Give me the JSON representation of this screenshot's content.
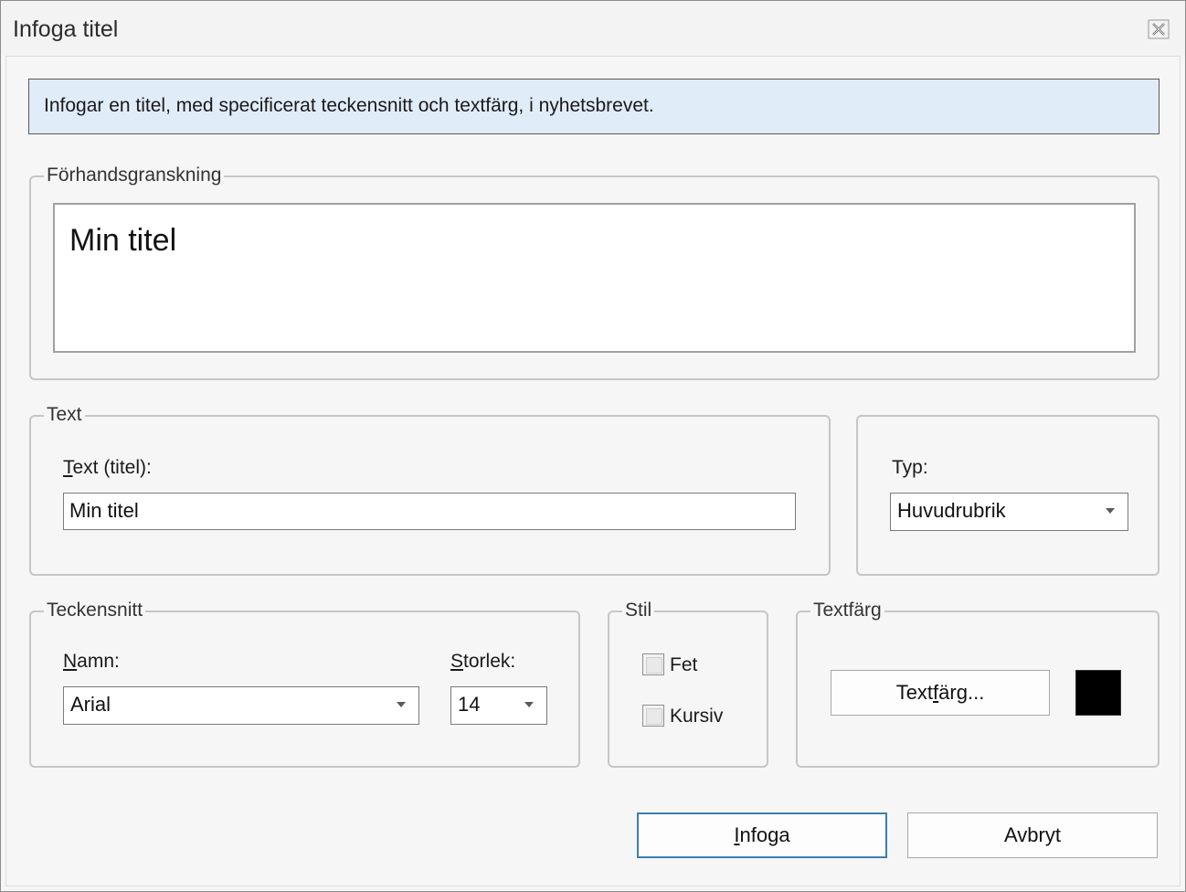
{
  "window": {
    "title": "Infoga titel",
    "close_icon": "close-icon"
  },
  "info": {
    "text": "Infogar en titel, med specificerat teckensnitt och textfärg, i nyhetsbrevet."
  },
  "preview": {
    "legend": "Förhandsgranskning",
    "text": "Min titel"
  },
  "text_group": {
    "legend": "Text",
    "label_mnemonic": "T",
    "label_rest": "ext (titel):",
    "value": "Min titel"
  },
  "type_group": {
    "label": "Typ:",
    "selected": "Huvudrubrik"
  },
  "font_group": {
    "legend": "Teckensnitt",
    "name_label_mnemonic": "N",
    "name_label_rest": "amn:",
    "name_value": "Arial",
    "size_label_mnemonic": "S",
    "size_label_rest": "torlek:",
    "size_value": "14"
  },
  "style_group": {
    "legend": "Stil",
    "bold_label": "Fet",
    "bold_checked": false,
    "italic_label": "Kursiv",
    "italic_checked": false
  },
  "color_group": {
    "legend": "Textfärg",
    "button_pre": "Text",
    "button_mnemonic": "f",
    "button_post": "ärg...",
    "swatch_color": "#000000"
  },
  "buttons": {
    "insert_mnemonic": "I",
    "insert_rest": "nfoga",
    "cancel": "Avbryt"
  }
}
